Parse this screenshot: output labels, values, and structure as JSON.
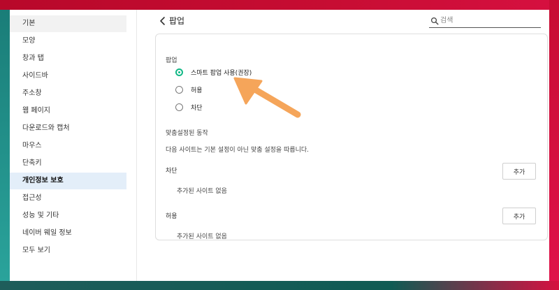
{
  "sidebar": {
    "items": [
      {
        "label": "기본"
      },
      {
        "label": "모양"
      },
      {
        "label": "창과 탭"
      },
      {
        "label": "사이드바"
      },
      {
        "label": "주소창"
      },
      {
        "label": "웹 페이지"
      },
      {
        "label": "다운로드와 캡처"
      },
      {
        "label": "마우스"
      },
      {
        "label": "단축키"
      },
      {
        "label": "개인정보 보호"
      },
      {
        "label": "접근성"
      },
      {
        "label": "성능 및 기타"
      },
      {
        "label": "네이버 웨일 정보"
      },
      {
        "label": "모두 보기"
      }
    ],
    "active_index": 9
  },
  "header": {
    "title": "팝업",
    "search_placeholder": "검색"
  },
  "popup": {
    "section_label": "팝업",
    "options": [
      {
        "label": "스마트 팝업 사용(권장)",
        "checked": true
      },
      {
        "label": "허용",
        "checked": false
      },
      {
        "label": "차단",
        "checked": false
      }
    ],
    "custom_title": "맞춤설정된 동작",
    "custom_desc": "다음 사이트는 기본 설정이 아닌 맞춤 설정을 따릅니다.",
    "block": {
      "label": "차단",
      "button": "추가",
      "empty": "추가된 사이트 없음"
    },
    "allow": {
      "label": "허용",
      "button": "추가",
      "empty": "추가된 사이트 없음"
    }
  },
  "colors": {
    "accent_radio": "#12b886",
    "annotation_arrow": "#f5a55a",
    "active_sidebar_bg": "#e3eef9"
  }
}
